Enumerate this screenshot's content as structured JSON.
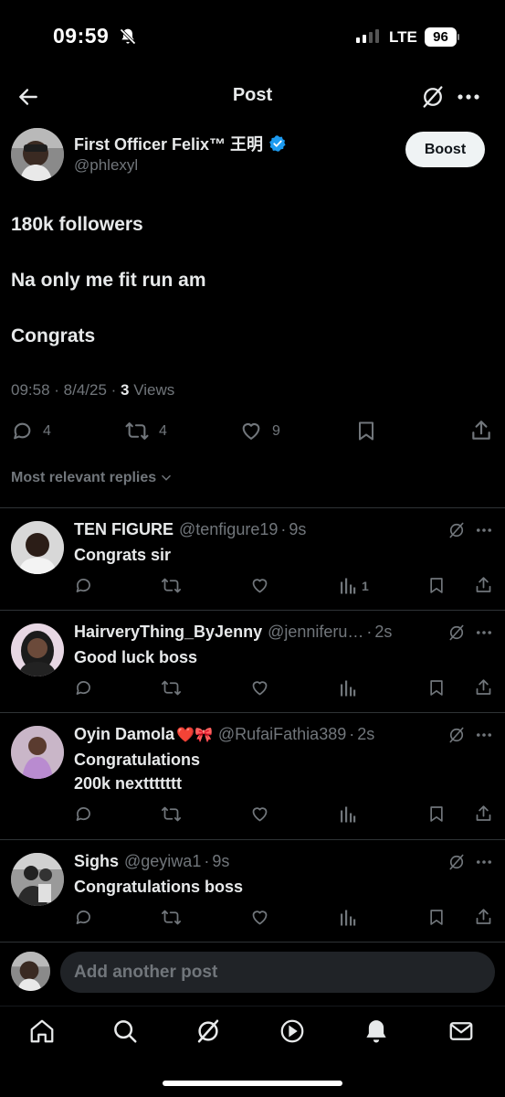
{
  "status_bar": {
    "time": "09:59",
    "network": "LTE",
    "battery": "96"
  },
  "header": {
    "title": "Post"
  },
  "post": {
    "author_name": "First Officer Felix™ 王明",
    "handle": "@phlexyl",
    "boost_label": "Boost",
    "lines": [
      "180k followers",
      "Na only me fit run am",
      "Congrats"
    ],
    "time": "09:58",
    "date": "8/4/25",
    "views_count": "3",
    "views_label": "Views",
    "replies": "4",
    "reposts": "4",
    "likes": "9"
  },
  "sort_label": "Most relevant replies",
  "replies": [
    {
      "name": "TEN FIGURE",
      "handle": "@tenfigure19",
      "time": "9s",
      "text": "Congrats sir",
      "views": "1"
    },
    {
      "name": "HairveryThing_ByJenny",
      "handle": "@jenniferu…",
      "time": "2s",
      "text": "Good luck boss",
      "views": ""
    },
    {
      "name": "Oyin Damola",
      "emoji": "❤️🎀",
      "handle": "@RufaiFathia389",
      "time": "2s",
      "text": "Congratulations",
      "text2": "200k nexttttttt",
      "views": ""
    },
    {
      "name": "Sighs",
      "handle": "@geyiwa1",
      "time": "9s",
      "text": "Congratulations boss",
      "views": ""
    }
  ],
  "composer": {
    "placeholder": "Add another post"
  },
  "icons": {
    "back": "arrow-left-icon",
    "grok": "grok-icon",
    "more": "more-icon",
    "reply": "reply-icon",
    "repost": "repost-icon",
    "like": "heart-icon",
    "views": "views-icon",
    "bookmark": "bookmark-icon",
    "share": "share-icon",
    "nav": [
      "home-icon",
      "search-icon",
      "grok-icon",
      "video-icon",
      "bell-icon",
      "mail-icon"
    ]
  },
  "colors": {
    "background": "#000000",
    "text": "#e7e9ea",
    "muted": "#71767b",
    "verified": "#1d9bf0",
    "divider": "#2f3336"
  }
}
